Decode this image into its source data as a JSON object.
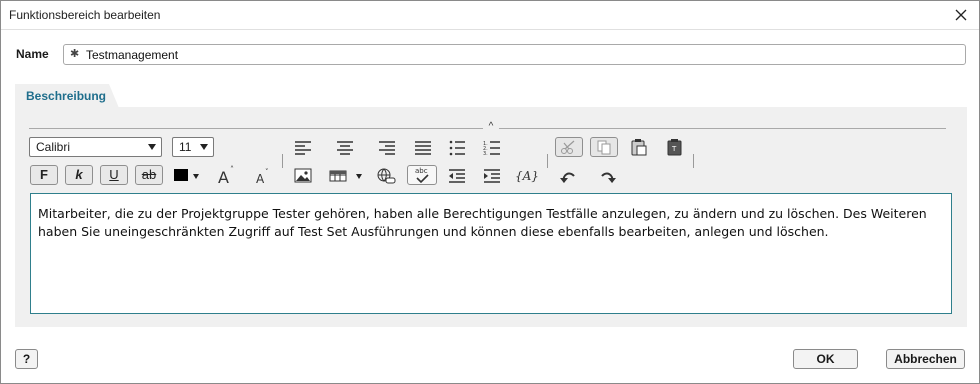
{
  "dialog": {
    "title": "Funktionsbereich bearbeiten"
  },
  "name_field": {
    "label": "Name",
    "required_mark": "✱",
    "value": "Testmanagement"
  },
  "tabs": [
    {
      "label": "Beschreibung"
    }
  ],
  "toolbar": {
    "font_family": "Calibri",
    "font_size": "11",
    "bold_label": "F",
    "italic_label": "k",
    "underline_label": "U",
    "strike_label": "ab",
    "text_color": "#000000",
    "variable_label": "{A}"
  },
  "editor": {
    "text": "Mitarbeiter, die zu der  Projektgruppe Tester gehören, haben alle Berechtigungen Testfälle anzulegen, zu ändern und zu löschen. Des Weiteren haben Sie uneingeschränkten Zugriff auf Test Set Ausführungen und können diese ebenfalls bearbeiten, anlegen und löschen."
  },
  "footer": {
    "help_label": "?",
    "ok_label": "OK",
    "cancel_label": "Abbrechen"
  },
  "colors": {
    "accent": "#1f6e8c",
    "editor_border": "#2f7f8c",
    "panel_bg": "#f0f0f0"
  }
}
